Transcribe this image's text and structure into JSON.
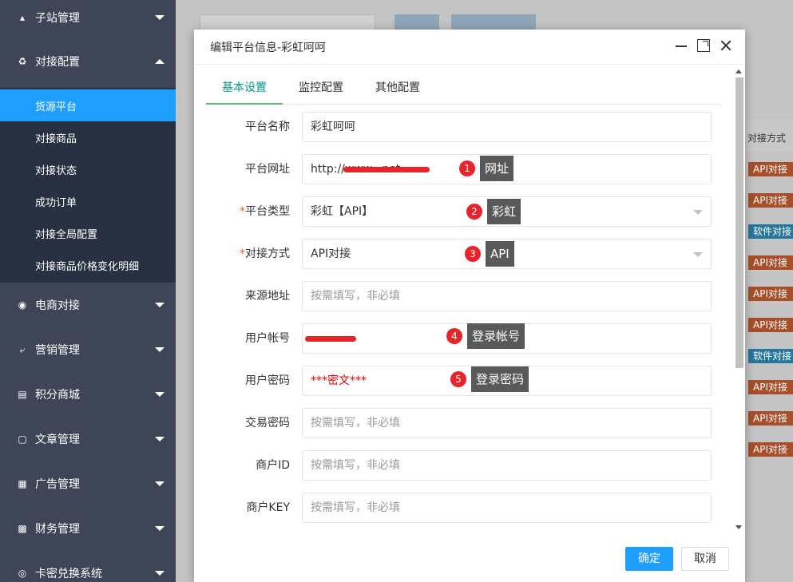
{
  "sidebar": {
    "groups": [
      {
        "label": "子站管理",
        "icon": "sitemap-icon"
      },
      {
        "label": "对接配置",
        "icon": "link-icon"
      },
      {
        "label": "电商对接",
        "icon": "lock-icon"
      },
      {
        "label": "营销管理",
        "icon": "share-icon"
      },
      {
        "label": "积分商城",
        "icon": "database-icon"
      },
      {
        "label": "文章管理",
        "icon": "document-icon"
      },
      {
        "label": "广告管理",
        "icon": "calendar-icon"
      },
      {
        "label": "财务管理",
        "icon": "ledger-icon"
      },
      {
        "label": "卡密兑换系统",
        "icon": "target-icon"
      }
    ],
    "submenu": [
      {
        "label": "货源平台",
        "active": true
      },
      {
        "label": "对接商品"
      },
      {
        "label": "对接状态"
      },
      {
        "label": "成功订单"
      },
      {
        "label": "对接全局配置"
      },
      {
        "label": "对接商品价格变化明细"
      }
    ]
  },
  "background": {
    "column_header": "对接方式",
    "tags": [
      "API对接",
      "API对接",
      "软件对接",
      "API对接",
      "API对接",
      "API对接",
      "软件对接",
      "API对接",
      "API对接",
      "API对接"
    ]
  },
  "dialog": {
    "title": "编辑平台信息-彩虹呵呵",
    "tabs": [
      "基本设置",
      "监控配置",
      "其他配置"
    ],
    "fields": {
      "name": {
        "label": "平台名称",
        "value": "彩虹呵呵"
      },
      "url": {
        "label": "平台网址",
        "value": "http://www.               .net"
      },
      "type": {
        "label": "平台类型",
        "value": "彩虹【API】"
      },
      "method": {
        "label": "对接方式",
        "value": "API对接"
      },
      "source": {
        "label": "来源地址",
        "placeholder": "按需填写，非必填"
      },
      "account": {
        "label": "用户帐号",
        "value": "        "
      },
      "password": {
        "label": "用户密码",
        "value": "***密文***"
      },
      "trade_password": {
        "label": "交易密码",
        "placeholder": "按需填写，非必填"
      },
      "merchant_id": {
        "label": "商户ID",
        "placeholder": "按需填写，非必填"
      },
      "merchant_key": {
        "label": "商户KEY",
        "placeholder": "按需填写，非必填"
      }
    },
    "callouts": [
      {
        "num": "1",
        "text": "网址"
      },
      {
        "num": "2",
        "text": "彩虹"
      },
      {
        "num": "3",
        "text": "API"
      },
      {
        "num": "4",
        "text": "登录帐号"
      },
      {
        "num": "5",
        "text": "登录密码"
      }
    ],
    "ok_label": "确定",
    "cancel_label": "取消",
    "required_mark": "*"
  }
}
